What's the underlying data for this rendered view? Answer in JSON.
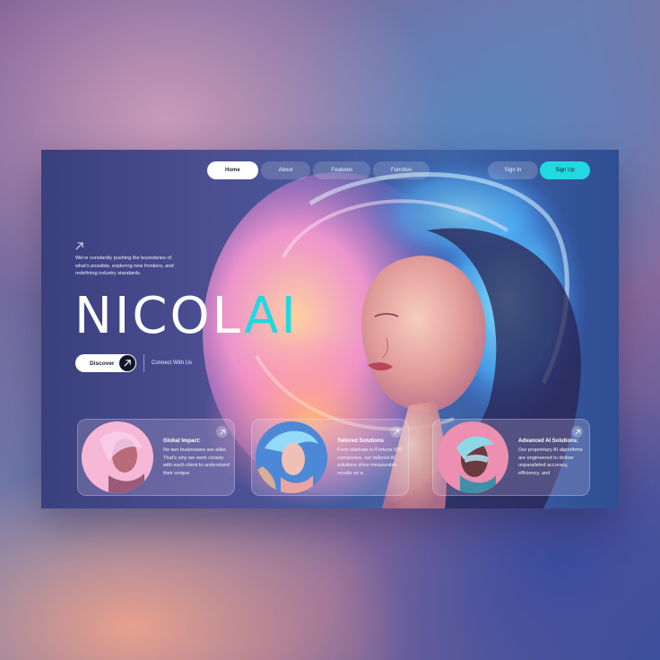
{
  "nav": {
    "items": [
      {
        "label": "Home",
        "active": true
      },
      {
        "label": "About",
        "active": false
      },
      {
        "label": "Features",
        "active": false
      },
      {
        "label": "Function",
        "active": false
      }
    ]
  },
  "auth": {
    "sign_in": "Sign In",
    "sign_up": "Sign Up"
  },
  "hero": {
    "arrow_icon": "arrow-up-right-icon",
    "tagline": "We're constantly pushing the boundaries of what's possible, exploring new frontiers, and redefining industry standards.",
    "brand_main": "NICOL",
    "brand_accent": "AI",
    "discover_label": "Discover",
    "connect_label": "Connect With Us"
  },
  "cards": [
    {
      "title": "Global Impact:",
      "description": "No two businesses are alike. That's why we work closely with each client to understand their unique"
    },
    {
      "title": "Tailored Solutions",
      "description": "From startups to Fortune 500 companies, our tailored AI solutions drive measurable results on a"
    },
    {
      "title": "Advanced AI Solutions:",
      "description": "Our proprietary AI algorithms are engineered to deliver unparalleled accuracy, efficiency, and"
    }
  ],
  "colors": {
    "accent": "#21d9e0",
    "dark": "#13162a"
  }
}
